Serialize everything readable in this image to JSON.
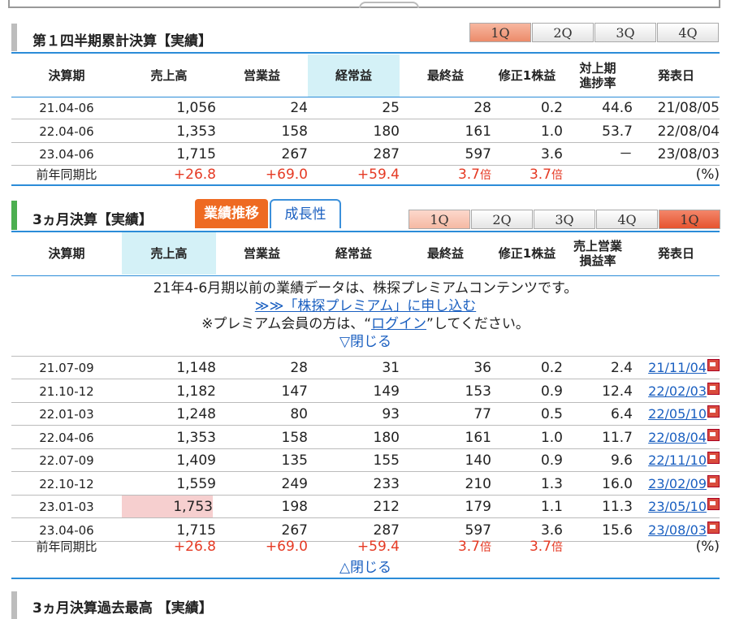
{
  "section1": {
    "title": "第１四半期累計決算【実績】",
    "tabs": [
      "1Q",
      "2Q",
      "3Q",
      "4Q"
    ],
    "headers": [
      "決算期",
      "売上高",
      "営業益",
      "経常益",
      "最終益",
      "修正1株益",
      "対上期\n進捗率",
      "発表日"
    ],
    "rows": [
      [
        "21.04-06",
        "1,056",
        "24",
        "25",
        "28",
        "0.2",
        "44.6",
        "21/08/05"
      ],
      [
        "22.04-06",
        "1,353",
        "158",
        "180",
        "161",
        "1.0",
        "53.7",
        "22/08/04"
      ],
      [
        "23.04-06",
        "1,715",
        "267",
        "287",
        "597",
        "3.6",
        "－",
        "23/08/03"
      ]
    ],
    "yoy": {
      "label": "前年同期比",
      "sales": "+26.8",
      "op": "+69.0",
      "ord": "+59.4",
      "net": "3.7",
      "net_unit": "倍",
      "eps": "3.7",
      "eps_unit": "倍",
      "unit": "(%)"
    }
  },
  "section2": {
    "title": "3ヵ月決算【実績】",
    "tab_trend": "業績推移",
    "tab_growth": "成長性",
    "qtabs": [
      "1Q",
      "2Q",
      "3Q",
      "4Q",
      "1Q"
    ],
    "headers": [
      "決算期",
      "売上高",
      "営業益",
      "経常益",
      "最終益",
      "修正1株益",
      "売上営業\n損益率",
      "発表日"
    ],
    "notice_line1": "21年4-6月期以前の業績データは、株探プレミアムコンテンツです。",
    "notice_link": "≫≫「株探プレミアム」に申し込む",
    "notice_line3_pre": "※プレミアム会員の方は、“",
    "notice_login": "ログイン",
    "notice_line3_post": "”してください。",
    "close_top": "▽閉じる",
    "rows": [
      [
        "21.07-09",
        "1,148",
        "28",
        "31",
        "36",
        "0.2",
        "2.4",
        "21/11/04"
      ],
      [
        "21.10-12",
        "1,182",
        "147",
        "149",
        "153",
        "0.9",
        "12.4",
        "22/02/03"
      ],
      [
        "22.01-03",
        "1,248",
        "80",
        "93",
        "77",
        "0.5",
        "6.4",
        "22/05/10"
      ],
      [
        "22.04-06",
        "1,353",
        "158",
        "180",
        "161",
        "1.0",
        "11.7",
        "22/08/04"
      ],
      [
        "22.07-09",
        "1,409",
        "135",
        "155",
        "140",
        "0.9",
        "9.6",
        "22/11/10"
      ],
      [
        "22.10-12",
        "1,559",
        "249",
        "233",
        "210",
        "1.3",
        "16.0",
        "23/02/09"
      ],
      [
        "23.01-03",
        "1,753",
        "198",
        "212",
        "179",
        "1.1",
        "11.3",
        "23/05/10"
      ],
      [
        "23.04-06",
        "1,715",
        "267",
        "287",
        "597",
        "3.6",
        "15.6",
        "23/08/03"
      ]
    ],
    "yoy": {
      "label": "前年同期比",
      "sales": "+26.8",
      "op": "+69.0",
      "ord": "+59.4",
      "net": "3.7",
      "net_unit": "倍",
      "eps": "3.7",
      "eps_unit": "倍",
      "unit": "(%)"
    },
    "close_bottom": "△閉じる"
  },
  "section3": {
    "title": "3ヵ月決算過去最高 【実績】"
  }
}
